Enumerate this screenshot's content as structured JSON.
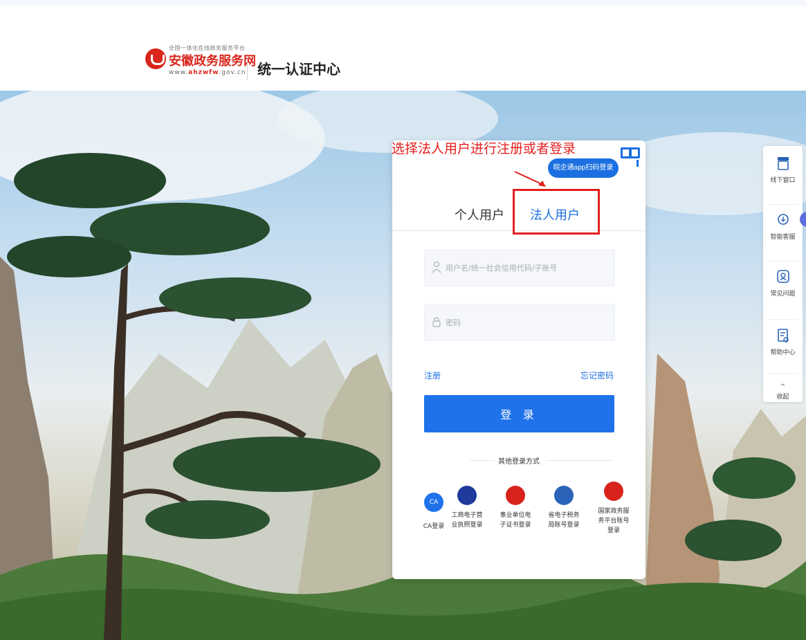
{
  "header": {
    "logo_slogan": "全国一体化在线政务服务平台",
    "logo_title": "安徽政务服务网",
    "logo_url_prefix": "www.",
    "logo_url_highlight": "ahzwfw",
    "logo_url_suffix": ".gov.cn",
    "title": "统一认证中心"
  },
  "annotation": {
    "text": "选择法人用户进行注册或者登录",
    "color": "#e41f1f"
  },
  "login": {
    "qr_button": "皖企通app扫码登录",
    "tabs": [
      {
        "label": "个人用户",
        "active": false
      },
      {
        "label": "法人用户",
        "active": true
      }
    ],
    "username_placeholder": "用户名/统一社会信用代码/子账号",
    "password_placeholder": "密码",
    "register": "注册",
    "forgot": "忘记密码",
    "submit": "登 录",
    "other_label": "其他登录方式",
    "methods": [
      {
        "label": "CA登录",
        "icon": "CA"
      },
      {
        "label": "工商电子营业执照登录",
        "icon": "badge-icon"
      },
      {
        "label": "事业单位电子证书登录",
        "icon": "temple-icon"
      },
      {
        "label": "省电子税务局账号登录",
        "icon": "tax-emblem-icon"
      },
      {
        "label": "国家政务服务平台账号登录",
        "icon": "national-emblem-icon"
      }
    ]
  },
  "sidebar": {
    "items": [
      {
        "label": "线下窗口",
        "icon": "store-icon"
      },
      {
        "label": "智能客服",
        "icon": "robot-icon"
      },
      {
        "label": "常见问题",
        "icon": "faq-icon"
      },
      {
        "label": "帮助中心",
        "icon": "help-doc-icon"
      },
      {
        "label": "收起",
        "icon": "chevron-up-icon"
      }
    ]
  },
  "colors": {
    "brand_red": "#d9261c",
    "primary_blue": "#1f72ea"
  }
}
